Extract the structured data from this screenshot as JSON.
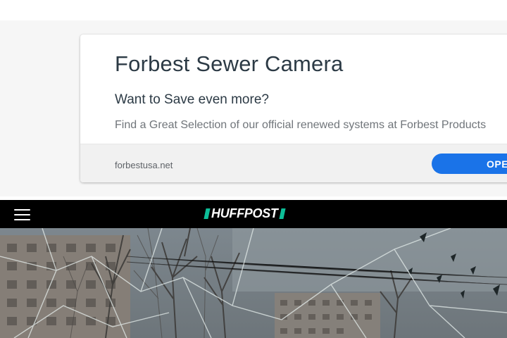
{
  "ad": {
    "title": "Forbest Sewer Camera",
    "subtitle": "Want to Save even more?",
    "description": "Find a Great Selection of our official renewed systems at Forbest Products",
    "url": "forbestusa.net",
    "button_label": "OPEN"
  },
  "header": {
    "menu_icon": "hamburger-menu-icon",
    "logo_text": "HUFFPOST",
    "colors": {
      "background": "#000000",
      "logo_accent": "#0dbe98"
    }
  },
  "hero": {
    "description_icon": "shattered-glass-photo"
  },
  "colors": {
    "ad_button": "#1a73e8",
    "ad_title": "#2c3a45",
    "ad_background": "#f6f6f6"
  }
}
